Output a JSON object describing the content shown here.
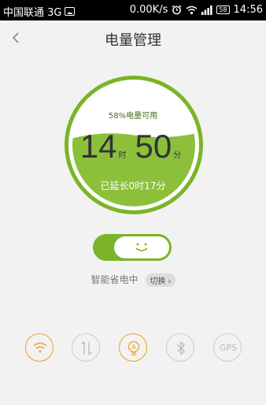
{
  "status_bar": {
    "carrier": "中国联通 3G",
    "speed": "0.00K/s",
    "battery_pct": "58",
    "time": "14:56"
  },
  "header": {
    "title": "电量管理"
  },
  "battery": {
    "available_text": "58%电量可用",
    "hours": "14",
    "hours_unit": "时",
    "minutes": "50",
    "minutes_unit": "分",
    "extended_text": "已延长0时17分",
    "level_fraction": 0.58
  },
  "toggle": {
    "on": true
  },
  "smart_mode": {
    "label": "智能省电中",
    "switch_label": "切换"
  },
  "quick_toggles": {
    "gps_label": "GPS"
  },
  "colors": {
    "accent_green": "#7bb428",
    "active_orange": "#f0a020",
    "inactive_gray": "#cccccc"
  }
}
